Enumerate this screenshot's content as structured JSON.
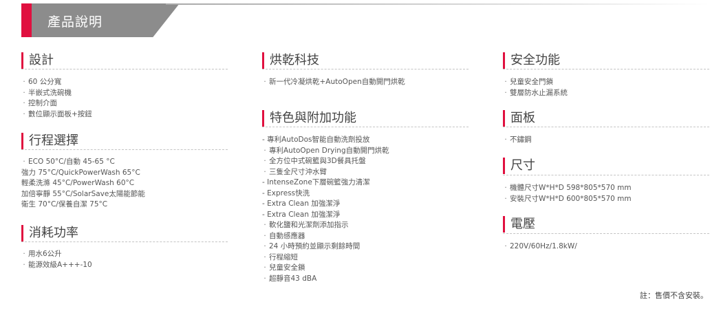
{
  "header": {
    "title": "產品說明"
  },
  "sections": {
    "design": {
      "title": "設計",
      "items": [
        "60 公分寬",
        "半嵌式洗碗機",
        "控制介面",
        "數位顯示面板+按鈕"
      ]
    },
    "programs": {
      "title": "行程選擇",
      "items": [
        "ECO 50°C/自動 45-65 °C",
        "強力 75°C/QuickPowerWash 65°C",
        "輕柔洗滌 45°C/PowerWash 60°C",
        "加倍寧靜 55°C/SolarSave太陽能節能",
        "衛生 70°C/保養自潔 75°C"
      ]
    },
    "power": {
      "title": "消耗功率",
      "items": [
        "用水6公升",
        "能源效級A+++-10"
      ]
    },
    "drying": {
      "title": "烘乾科技",
      "items": [
        "新一代冷凝烘乾+AutoOpen自動開門烘乾"
      ]
    },
    "features": {
      "title": "特色與附加功能",
      "items": [
        "專利AutoDos智能自動洗劑投放",
        "專利AutoOpen Drying自動開門烘乾",
        "全方位中式碗籃與3D餐具托盤",
        "三隻全尺寸沖水臂",
        "IntenseZone下層碗籃強力清潔",
        "Express快洗",
        "Extra Clean 加強潔淨",
        "Extra Clean 加強潔淨",
        "軟化鹽和光潔劑添加指示",
        "自動感應器",
        "24 小時預約並顯示剩餘時間",
        "行程縮短",
        "兒童安全鎖",
        "超靜音43 dBA"
      ]
    },
    "safety": {
      "title": "安全功能",
      "items": [
        "兒童安全門鎖",
        "雙層防水止漏系統"
      ]
    },
    "panel": {
      "title": "面板",
      "items": [
        "不鏽鋼"
      ]
    },
    "size": {
      "title": "尺寸",
      "items": [
        "機體尺寸W*H*D 598*805*570 mm",
        "安裝尺寸W*H*D 600*805*570 mm"
      ]
    },
    "voltage": {
      "title": "電壓",
      "items": [
        "220V/60Hz/1.8kW/"
      ]
    }
  },
  "note": "註：售價不含安裝。"
}
